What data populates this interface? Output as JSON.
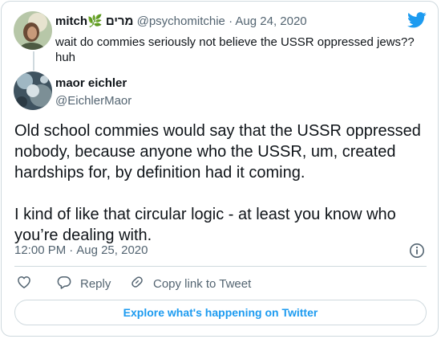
{
  "parent_tweet": {
    "display_name": "mitch🌿 מרים",
    "handle": "@psychomitchie",
    "separator": "·",
    "date": "Aug 24, 2020",
    "text": "wait do commies seriously not believe the USSR oppressed jews?? huh",
    "avatar_icon": "user-avatar-photo"
  },
  "tweet": {
    "display_name": "maor eichler",
    "handle": "@EichlerMaor",
    "avatar_icon": "user-avatar-photo",
    "paragraphs": [
      "Old school commies would say that the USSR oppressed nobody, because anyone who the USSR, um, created hardships for, by definition had it coming.",
      "I kind of like that circular logic - at least you know who you’re dealing with."
    ],
    "time": "12:00 PM",
    "separator": "·",
    "date": "Aug 25, 2020"
  },
  "actions": {
    "like_icon": "heart-icon",
    "reply_label": "Reply",
    "reply_icon": "comment-icon",
    "copy_label": "Copy link to Tweet",
    "copy_icon": "link-icon"
  },
  "explore_label": "Explore what's happening on Twitter",
  "colors": {
    "accent": "#1d9bf0",
    "text": "#0f1419",
    "secondary": "#536471",
    "border": "#cfd9de"
  }
}
